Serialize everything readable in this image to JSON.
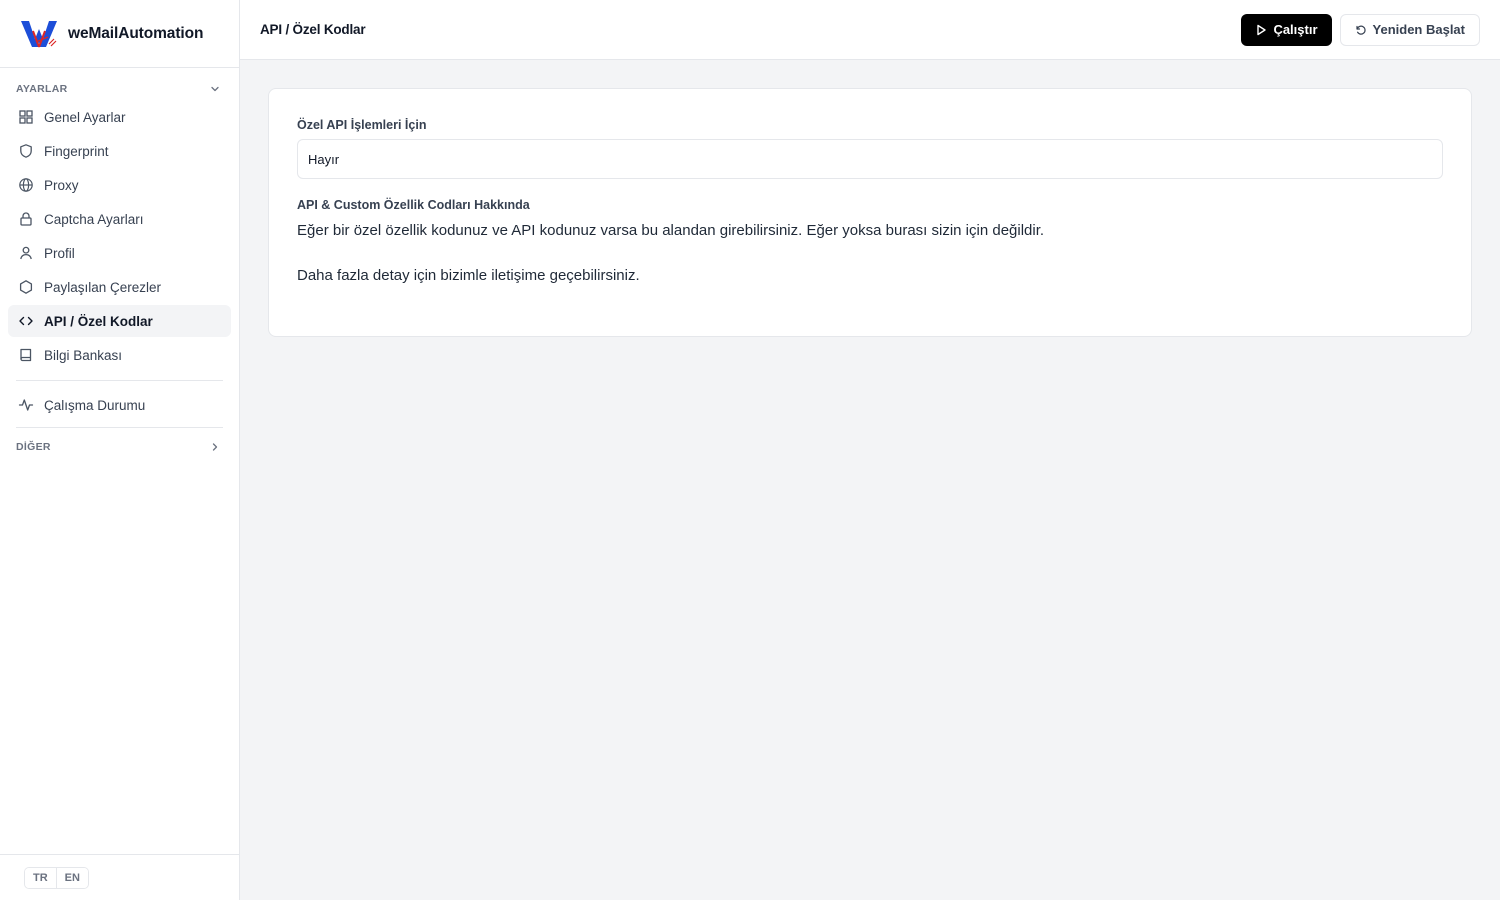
{
  "app": {
    "name": "weMailAutomation"
  },
  "sidebar": {
    "settings_header": "AYARLAR",
    "items": [
      {
        "label": "Genel Ayarlar",
        "icon": "grid-icon"
      },
      {
        "label": "Fingerprint",
        "icon": "shield-icon"
      },
      {
        "label": "Proxy",
        "icon": "globe-icon"
      },
      {
        "label": "Captcha Ayarları",
        "icon": "lock-icon"
      },
      {
        "label": "Profil",
        "icon": "user-icon"
      },
      {
        "label": "Paylaşılan Çerezler",
        "icon": "hexagon-icon"
      },
      {
        "label": "API / Özel Kodlar",
        "icon": "code-icon",
        "active": true
      },
      {
        "label": "Bilgi Bankası",
        "icon": "book-icon"
      }
    ],
    "status_item": {
      "label": "Çalışma Durumu",
      "icon": "activity-icon"
    },
    "other_header": "DİĞER",
    "languages": [
      "TR",
      "EN"
    ]
  },
  "header": {
    "title": "API / Özel Kodlar",
    "run_label": "Çalıştır",
    "restart_label": "Yeniden Başlat"
  },
  "main": {
    "api_field_label": "Özel API İşlemleri İçin",
    "api_field_value": "Hayır",
    "about_label": "API & Custom Özellik Codları Hakkında",
    "paragraph1": "Eğer bir özel özellik kodunuz ve API kodunuz varsa bu alandan girebilirsiniz. Eğer yoksa burası sizin için değildir.",
    "paragraph2": "Daha fazla detay için bizimle iletişime geçebilirsiniz."
  },
  "colors": {
    "primary_button": "#000000",
    "logo_blue": "#1d4ed8",
    "logo_red": "#dc2626"
  }
}
